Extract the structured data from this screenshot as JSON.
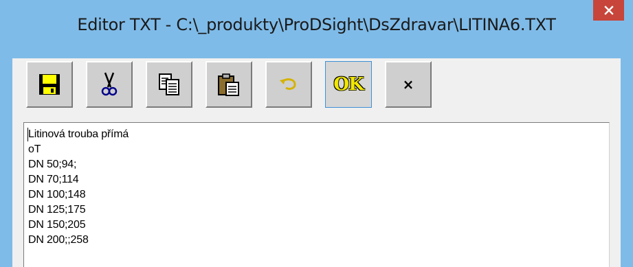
{
  "window": {
    "title": "Editor TXT - C:\\_produkty\\ProDSight\\DsZdravar\\LITINA6.TXT",
    "close_icon": "close-icon",
    "colors": {
      "titlebar": "#7fbbe8",
      "close": "#c7453a"
    }
  },
  "toolbar": {
    "buttons": [
      {
        "name": "save",
        "icon": "floppy-disk-icon"
      },
      {
        "name": "cut",
        "icon": "scissors-icon"
      },
      {
        "name": "copy",
        "icon": "copy-icon"
      },
      {
        "name": "paste",
        "icon": "clipboard-paste-icon"
      },
      {
        "name": "undo",
        "icon": "undo-arrow-icon"
      },
      {
        "name": "ok",
        "label": "OK"
      },
      {
        "name": "cancel",
        "label": "×"
      }
    ]
  },
  "editor": {
    "lines": [
      "Litinová trouba přímá",
      "oT",
      "DN 50;94;",
      "DN 70;114",
      "DN 100;148",
      "DN 125;175",
      "DN 150;205",
      "DN 200;;258"
    ]
  }
}
